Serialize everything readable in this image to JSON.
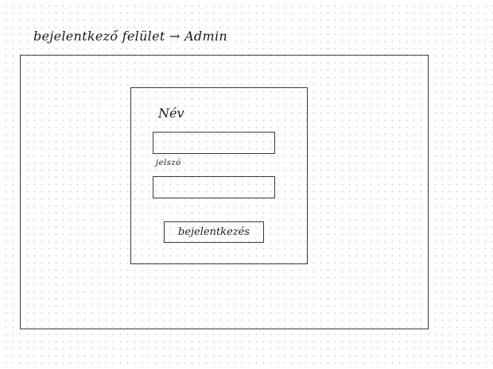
{
  "header": {
    "title": "bejelentkező felület → Admin"
  },
  "login_form": {
    "name_label": "Név",
    "name_value": "",
    "password_label": "jelszó",
    "password_value": "",
    "submit_label": "bejelentkezés"
  }
}
